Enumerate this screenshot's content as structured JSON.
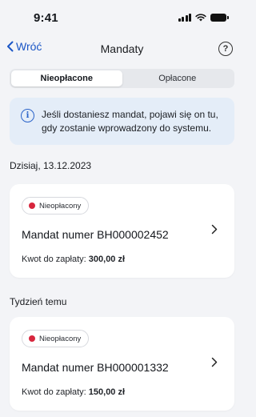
{
  "status_bar": {
    "time": "9:41",
    "icons": [
      "cellular-signal-icon",
      "wifi-icon",
      "battery-icon"
    ]
  },
  "nav": {
    "back_label": "Wróć",
    "title": "Mandaty",
    "help_symbol": "?"
  },
  "tabs": [
    {
      "label": "Nieopłacone",
      "active": true
    },
    {
      "label": "Opłacone",
      "active": false
    }
  ],
  "info": {
    "icon_symbol": "i",
    "line1": "Jeśli dostaniesz mandat, pojawi się on tu,",
    "line2": "gdy zostanie wprowadzony do systemu."
  },
  "sections": [
    {
      "label": "Dzisiaj, 13.12.2023",
      "ticket": {
        "status": "Nieopłacony",
        "title": "Mandat numer BH000002452",
        "amount_label": "Kwot do zapłaty:",
        "amount_value": "300,00 zł"
      }
    },
    {
      "label": "Tydzień temu",
      "ticket": {
        "status": "Nieopłacony",
        "title": "Mandat numer BH000001332",
        "amount_label": "Kwot do zapłaty:",
        "amount_value": "150,00 zł"
      }
    }
  ],
  "colors": {
    "accent": "#1a56c6",
    "background": "#f3f4f7",
    "info_background": "#e4edf8",
    "status_unpaid": "#d7263d"
  }
}
